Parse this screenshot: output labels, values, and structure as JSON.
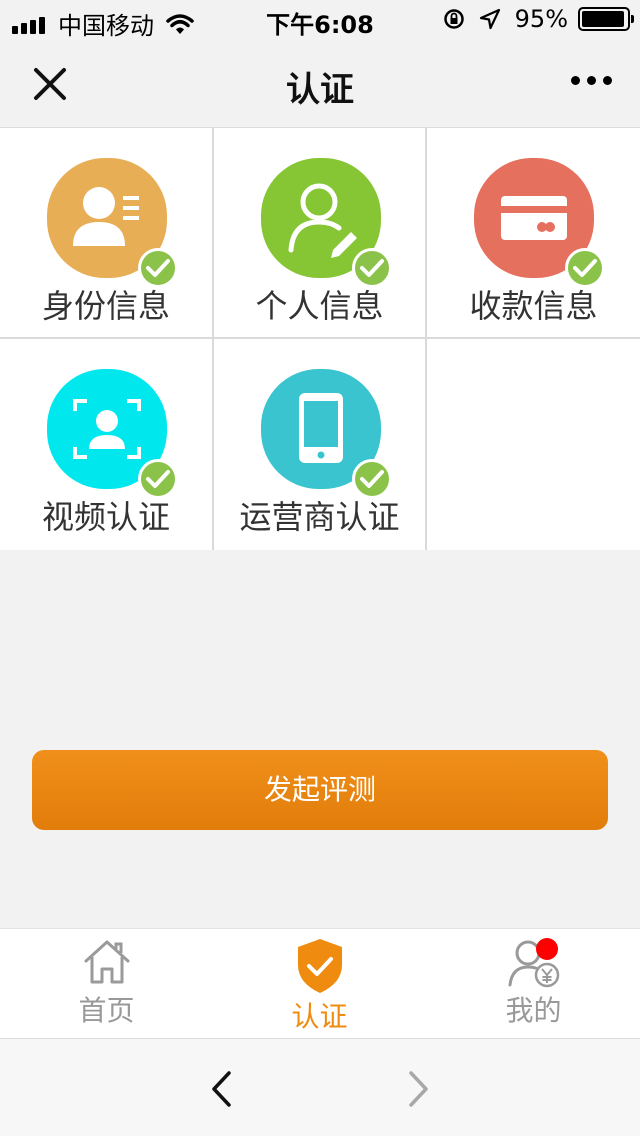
{
  "status_bar": {
    "carrier": "中国移动",
    "time": "下午6:08",
    "battery": "95%",
    "battery_level": 0.95
  },
  "nav": {
    "title": "认证",
    "close_icon": "close-icon",
    "more_icon": "more-icon"
  },
  "items": [
    {
      "label": "身份信息",
      "color": "#e8ae55",
      "icon": "id-card-icon",
      "status": "verified"
    },
    {
      "label": "个人信息",
      "color": "#86c534",
      "icon": "person-edit-icon",
      "status": "verified"
    },
    {
      "label": "收款信息",
      "color": "#e6705e",
      "icon": "bank-card-icon",
      "status": "verified"
    },
    {
      "label": "视频认证",
      "color": "#00e8ee",
      "icon": "face-scan-icon",
      "status": "verified"
    },
    {
      "label": "运营商认证",
      "color": "#3ac4cf",
      "icon": "phone-icon",
      "status": "verified"
    }
  ],
  "action": {
    "evaluate_label": "发起评测",
    "color": "#e98612"
  },
  "tabs": [
    {
      "label": "首页",
      "icon": "home-icon",
      "active": false
    },
    {
      "label": "认证",
      "icon": "shield-check-icon",
      "active": true
    },
    {
      "label": "我的",
      "icon": "user-yuan-icon",
      "active": false,
      "badge": true
    }
  ],
  "colors": {
    "accent": "#ef8c10",
    "check": "#8bc34a",
    "badge": "#ff0000"
  }
}
